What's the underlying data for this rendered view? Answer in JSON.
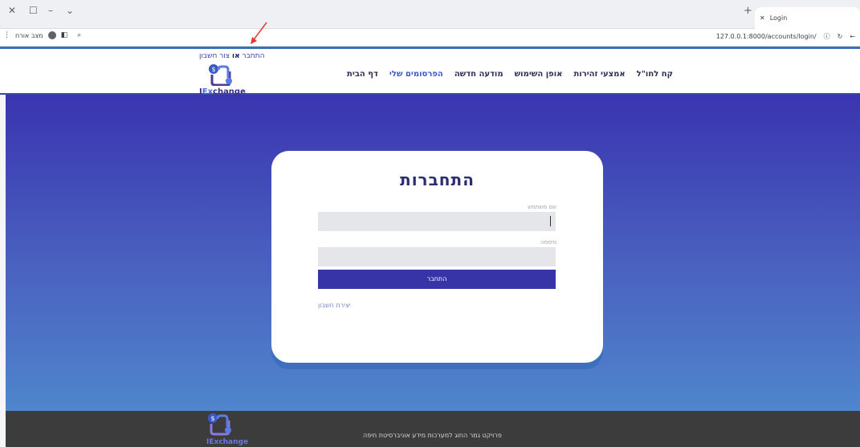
{
  "browser": {
    "tab_title": "Login",
    "url": "127.0.0.1:8000/accounts/login/",
    "guest_label": "מצב אורח"
  },
  "header": {
    "login_link": "התחבר",
    "or_text": "או",
    "signup_link": "צור חשבון",
    "logo_text_i": "I",
    "logo_text_ex": "Ex",
    "logo_text_change": "change",
    "nav": [
      "דף הבית",
      "הפרסומים שלי",
      "מודעה חדשה",
      "אופן השימוש",
      "אמצעי זהירות",
      "קח לחו\"ל"
    ]
  },
  "login": {
    "title": "התחברות",
    "username_label": "שם משתמש",
    "password_label": "סיסמה",
    "submit_label": "התחבר",
    "create_account": "יצירת חשבון"
  },
  "footer": {
    "text": "פרויקט גמר החוג למערכות מידע אוניברסיטת חיפה"
  },
  "colors": {
    "primary": "#3734a8",
    "accent": "#3b6fb6"
  }
}
